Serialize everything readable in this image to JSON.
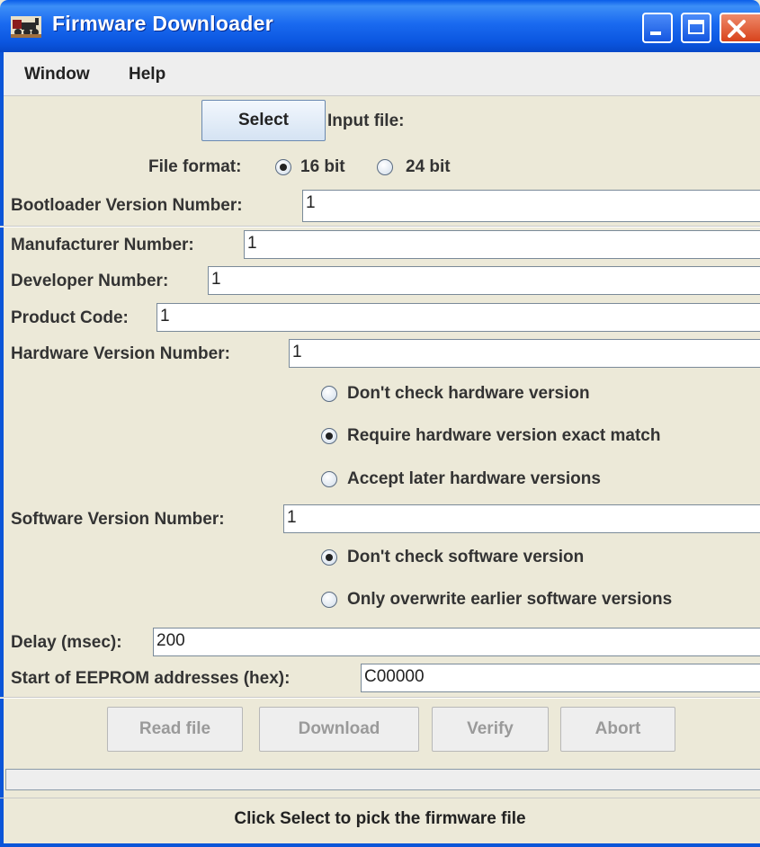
{
  "window": {
    "title": "Firmware Downloader"
  },
  "menubar": {
    "items": [
      "Window",
      "Help"
    ]
  },
  "input": {
    "select_label": "Select",
    "input_file_label": "Input file:"
  },
  "file_format": {
    "label": "File format:",
    "options": [
      "16 bit",
      "24 bit"
    ],
    "selected": "16 bit"
  },
  "fields": {
    "bootloader_label": "Bootloader Version Number:",
    "bootloader_value": "1",
    "manufacturer_label": "Manufacturer Number:",
    "manufacturer_value": "1",
    "developer_label": "Developer Number:",
    "developer_value": "1",
    "product_label": "Product Code:",
    "product_value": "1",
    "hardware_label": "Hardware Version Number:",
    "hardware_value": "1",
    "software_label": "Software Version Number:",
    "software_value": "1",
    "delay_label": "Delay (msec):",
    "delay_value": "200",
    "eeprom_label": "Start of EEPROM addresses (hex):",
    "eeprom_value": "C00000"
  },
  "hardware_check": {
    "options": [
      "Don't check hardware version",
      "Require hardware version exact match",
      "Accept later hardware versions"
    ],
    "selected": "Require hardware version exact match"
  },
  "software_check": {
    "options": [
      "Don't check software version",
      "Only overwrite earlier software versions"
    ],
    "selected": "Don't check software version"
  },
  "actions": {
    "read_file": "Read file",
    "download": "Download",
    "verify": "Verify",
    "abort": "Abort"
  },
  "progress": {
    "value": 0
  },
  "status": {
    "text": "Click Select to pick the firmware file"
  }
}
